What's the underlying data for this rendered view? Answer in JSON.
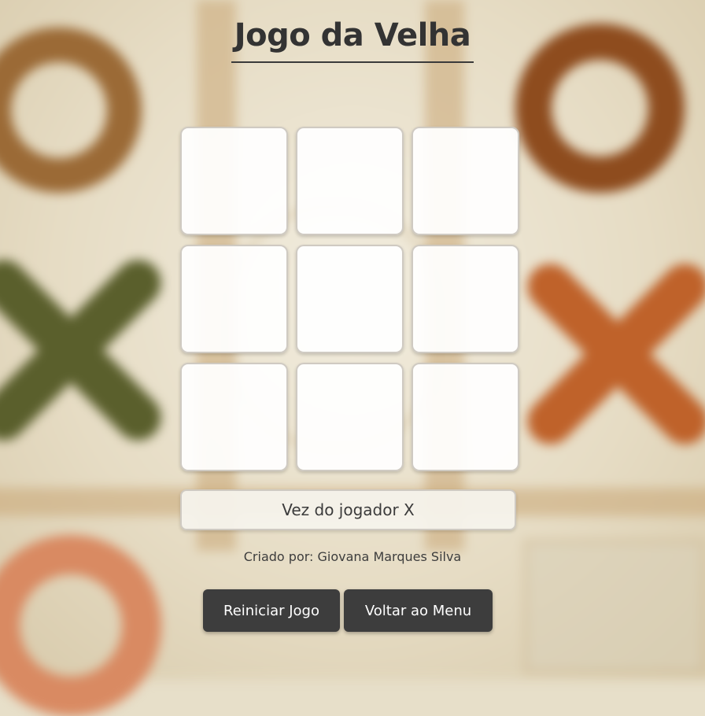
{
  "title": "Jogo da Velha",
  "board": {
    "cells": [
      "",
      "",
      "",
      "",
      "",
      "",
      "",
      "",
      ""
    ]
  },
  "status": "Vez do jogador X",
  "credits": "Criado por: Giovana Marques Silva",
  "buttons": {
    "restart": "Reiniciar Jogo",
    "menu": "Voltar ao Menu"
  },
  "colors": {
    "button_bg": "#3d3d3d",
    "title_text": "#333333",
    "cell_bg": "#ffffff",
    "background": "#e7dfc9"
  },
  "background_decor": [
    "o-ring-icon",
    "x-mark-icon"
  ]
}
